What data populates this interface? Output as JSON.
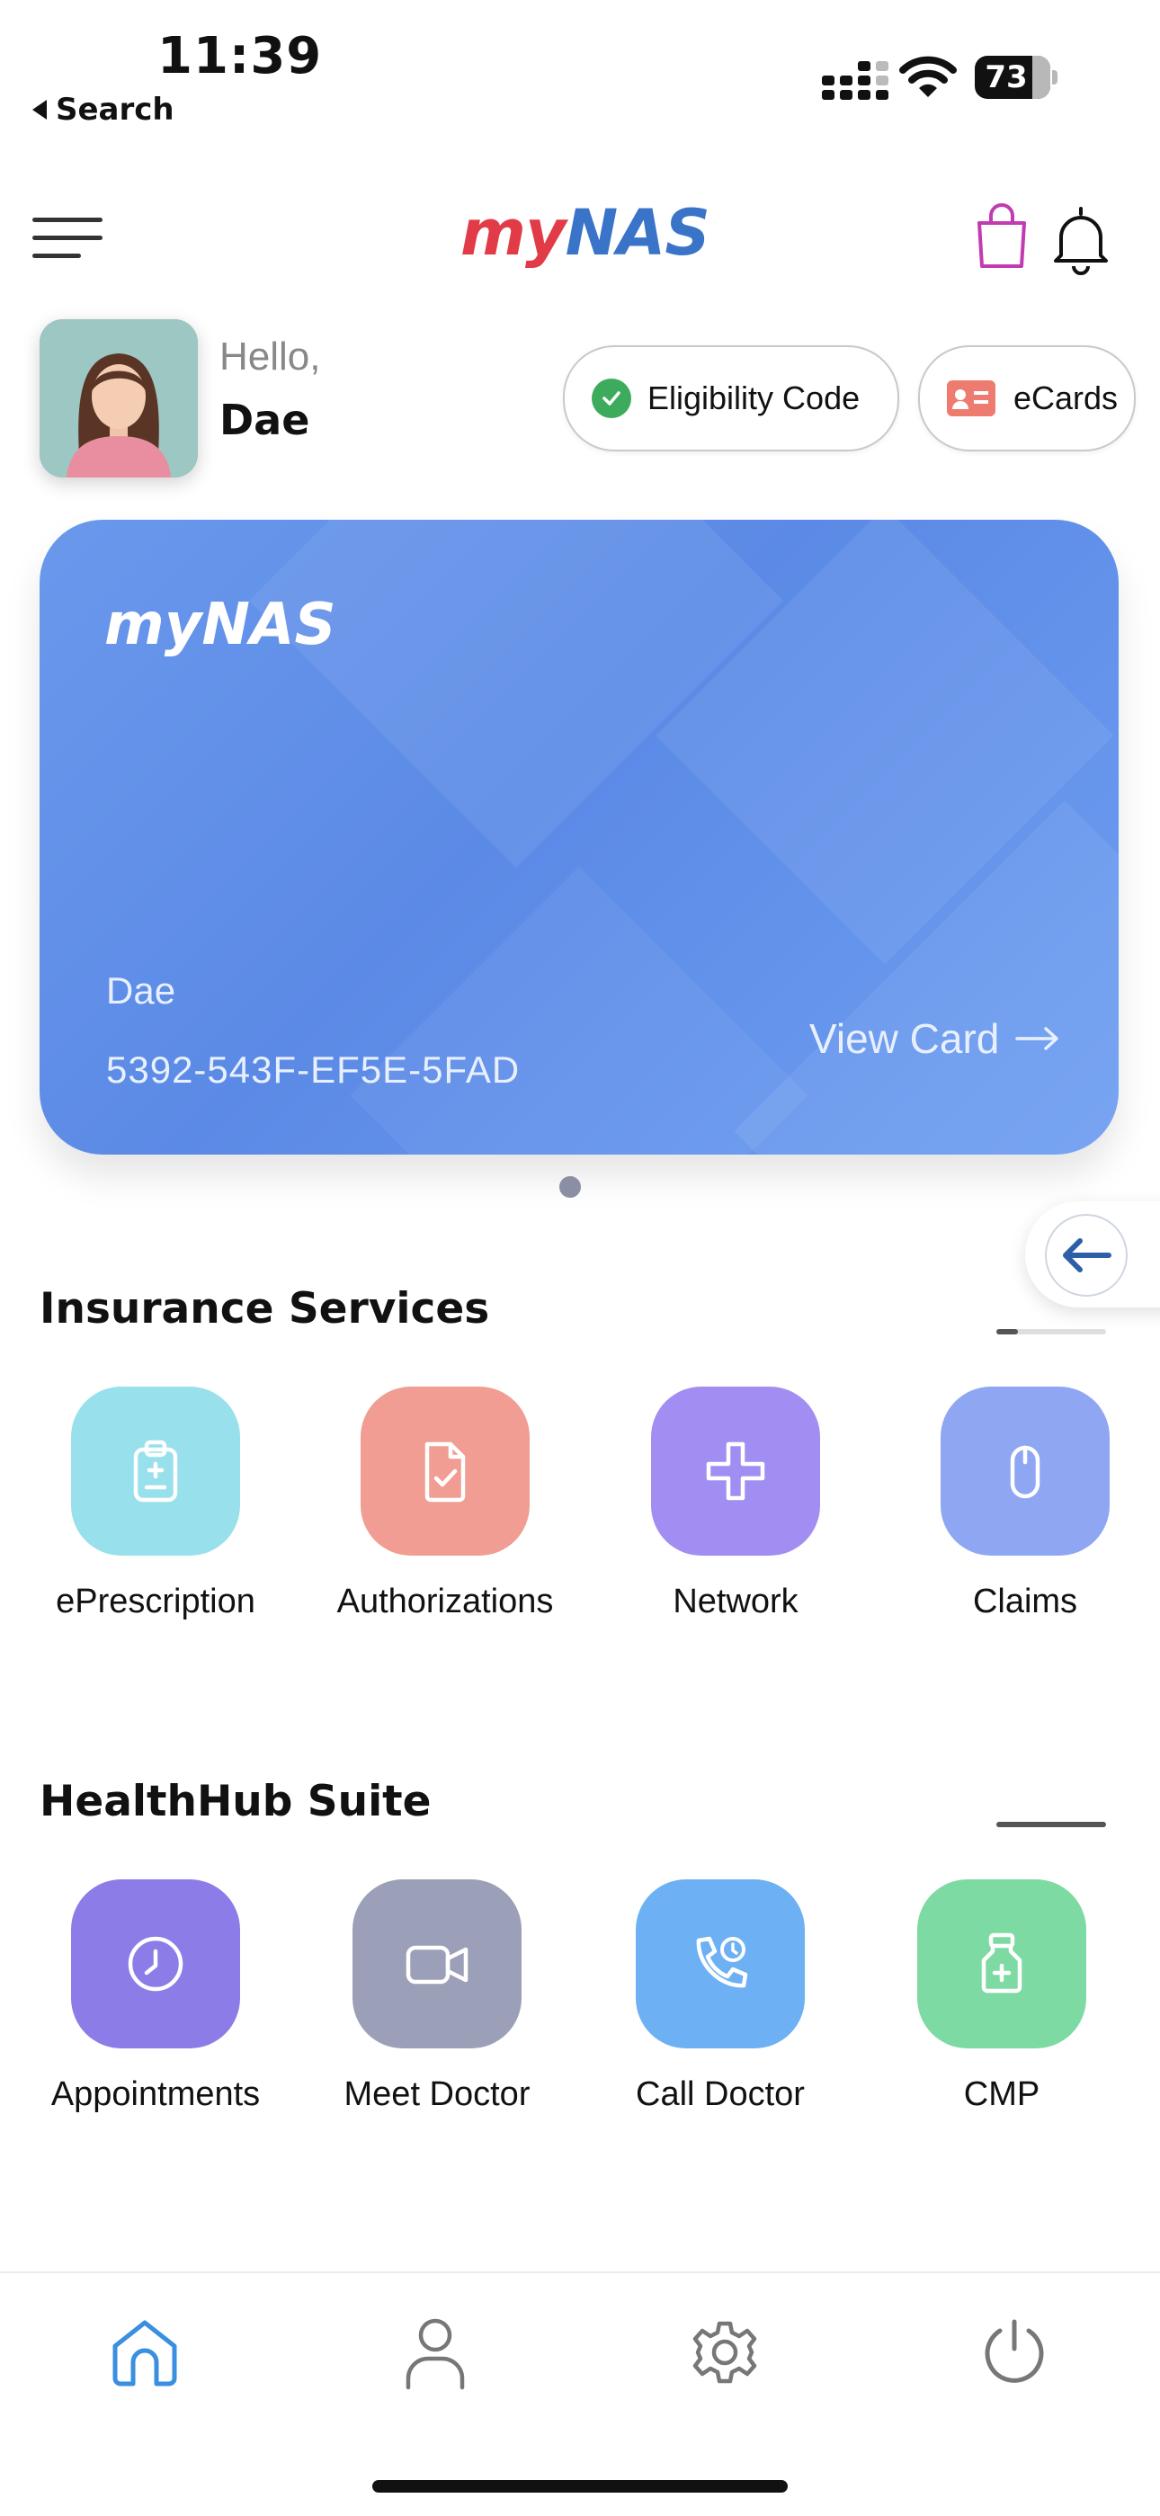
{
  "status_bar": {
    "time": "11:39",
    "back_label": "Search",
    "battery": "73"
  },
  "header": {
    "logo_my": "my",
    "logo_nas": "NAS",
    "icons": [
      "menu-icon",
      "shopping-bag-icon",
      "bell-icon"
    ]
  },
  "greeting": {
    "hello": "Hello,",
    "name": "Dae"
  },
  "actions": {
    "eligibility_label": "Eligibility Code",
    "ecards_label": "eCards"
  },
  "card": {
    "logo_my": "my",
    "logo_nas": "NAS",
    "member_name": "Dae",
    "member_number": "5392-543F-EF5E-5FAD",
    "view_label": "View Card"
  },
  "insurance": {
    "title": "Insurance Services",
    "items": [
      {
        "label": "ePrescription",
        "color": "#98e0ec",
        "icon": "clipboard-icon"
      },
      {
        "label": "Authorizations",
        "color": "#f19d93",
        "icon": "document-check-icon"
      },
      {
        "label": "Network",
        "color": "#a28ef2",
        "icon": "plus-icon"
      },
      {
        "label": "Claims",
        "color": "#8fa6f3",
        "icon": "capsule-icon"
      }
    ]
  },
  "healthhub": {
    "title": "HealthHub Suite",
    "items": [
      {
        "label": "Appointments",
        "color": "#8c7ce8",
        "icon": "clock-icon"
      },
      {
        "label": "Meet Doctor",
        "color": "#9c9fb8",
        "icon": "video-icon"
      },
      {
        "label": "Call Doctor",
        "color": "#6db0f3",
        "icon": "phone-clock-icon"
      },
      {
        "label": "CMP",
        "color": "#7ddaa2",
        "icon": "medicine-bottle-icon"
      }
    ]
  },
  "bottom_nav": {
    "items": [
      "home-icon",
      "profile-icon",
      "settings-icon",
      "power-icon"
    ],
    "active_color": "#3a8fe0"
  }
}
